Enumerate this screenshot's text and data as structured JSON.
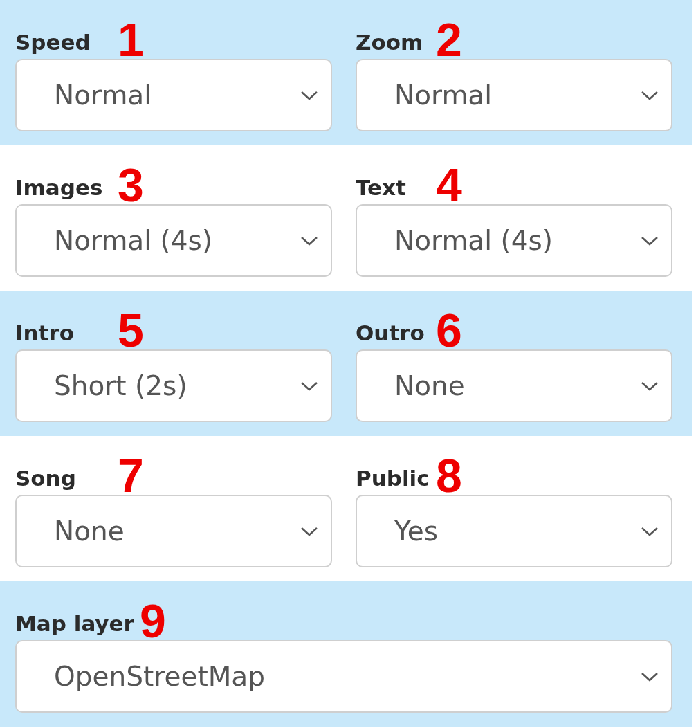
{
  "rows": [
    {
      "shaded": true,
      "fields": [
        {
          "label": "Speed",
          "marker": "1",
          "value": "Normal"
        },
        {
          "label": "Zoom",
          "marker": "2",
          "value": "Normal"
        }
      ]
    },
    {
      "shaded": false,
      "fields": [
        {
          "label": "Images",
          "marker": "3",
          "value": "Normal (4s)"
        },
        {
          "label": "Text",
          "marker": "4",
          "value": "Normal (4s)"
        }
      ]
    },
    {
      "shaded": true,
      "fields": [
        {
          "label": "Intro",
          "marker": "5",
          "value": "Short (2s)"
        },
        {
          "label": "Outro",
          "marker": "6",
          "value": "None"
        }
      ]
    },
    {
      "shaded": false,
      "fields": [
        {
          "label": "Song",
          "marker": "7",
          "value": "None"
        },
        {
          "label": "Public",
          "marker": "8",
          "value": "Yes"
        }
      ]
    },
    {
      "shaded": true,
      "fields": [
        {
          "label": "Map layer",
          "marker": "9",
          "value": "OpenStreetMap"
        }
      ]
    }
  ]
}
